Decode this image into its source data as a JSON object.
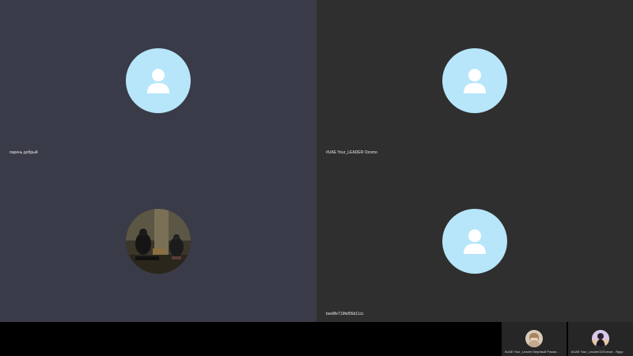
{
  "participants": [
    {
      "name": "парень добрый",
      "avatar": "person-icon",
      "avatar_color": "#b7e6fa"
    },
    {
      "name": "#UAE Your_LEADER Ozomo",
      "avatar": "person-icon",
      "avatar_color": "#b7e6fa"
    },
    {
      "name": "",
      "avatar": "photo"
    },
    {
      "name": "bxe8fe719fef95d11cc",
      "avatar": "person-icon",
      "avatar_color": "#b7e6fa"
    }
  ],
  "thumbnails": [
    {
      "name": "#UAE Your_Leader Мертвый Роман..."
    },
    {
      "name": "#UAE Your_LeaderCDSvecar - Яррр"
    }
  ],
  "colors": {
    "tile_left": "#3a3b48",
    "tile_right": "#2f2f2f",
    "avatar_bg": "#b7e6fa",
    "bar_bg": "#000000"
  }
}
